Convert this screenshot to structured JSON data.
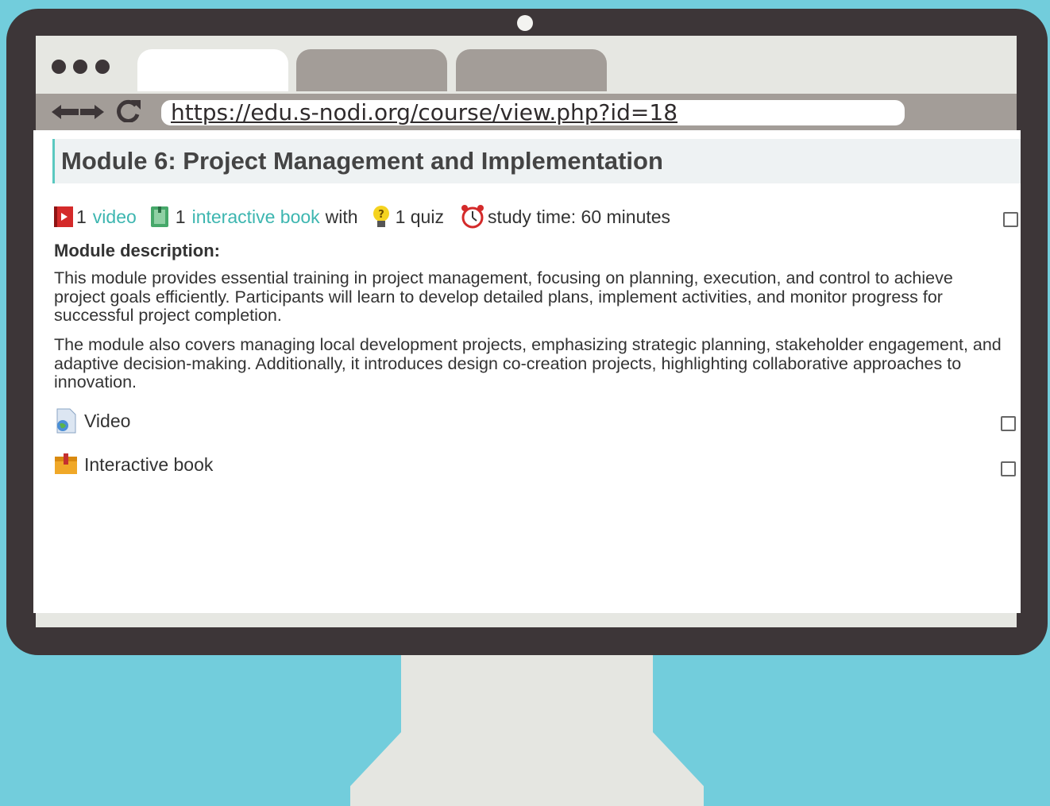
{
  "browser": {
    "url": "https://edu.s-nodi.org/course/view.php?id=18",
    "back_icon": "arrow-left-icon",
    "forward_icon": "arrow-right-icon",
    "reload_icon": "reload-icon"
  },
  "module": {
    "title": "Module 6: Project Management and Implementation",
    "meta": {
      "video_count": "1",
      "video_label": "video",
      "book_count": "1",
      "book_label": "interactive book",
      "with": "with",
      "quiz": "1 quiz",
      "study_time": "study time: 60 minutes"
    },
    "description_heading": "Module description:",
    "paragraphs": [
      "This module provides essential training in project management, focusing on planning, execution, and control to achieve project goals efficiently. Participants will learn to develop detailed plans, implement activities, and monitor progress for successful project completion.",
      "The module also covers managing local development projects, emphasizing strategic planning, stakeholder engagement, and adaptive decision-making. Additionally, it introduces design co-creation projects, highlighting collaborative approaches to innovation."
    ],
    "activities": [
      {
        "label": "Video",
        "icon": "video-file-icon"
      },
      {
        "label": "Interactive book",
        "icon": "book-package-icon"
      }
    ]
  },
  "colors": {
    "background": "#72cddc",
    "monitor": "#3d3638",
    "link": "#3db6b0",
    "title_accent": "#5ac8c0"
  }
}
